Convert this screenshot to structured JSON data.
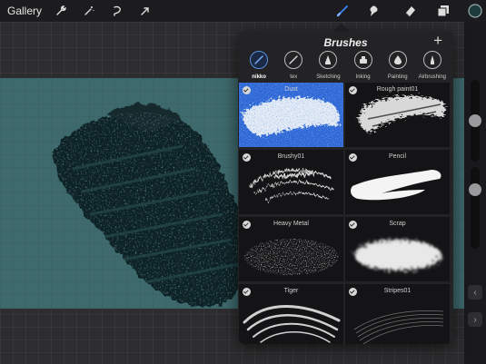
{
  "toolbar": {
    "gallery_label": "Gallery",
    "left_tools": [
      "wrench-icon",
      "magic-wand-icon",
      "selection-icon",
      "transform-arrow-icon"
    ],
    "right_tools": [
      "brush-icon",
      "smudge-icon",
      "eraser-icon",
      "layers-icon",
      "color-icon"
    ],
    "active_tool": "brush-icon",
    "accent": "#3a86ff",
    "current_color": "#1d3a3c"
  },
  "canvas": {
    "background": "#3e6a6d",
    "stroke_color": "#0f2426"
  },
  "brushes_panel": {
    "title": "Brushes",
    "add_label": "+",
    "sets": [
      {
        "label": "nikko",
        "icon": "pen-icon",
        "active": true
      },
      {
        "label": "tex",
        "icon": "brush-icon",
        "active": false
      },
      {
        "label": "Sketching",
        "icon": "pencil-tip-icon",
        "active": false
      },
      {
        "label": "Inking",
        "icon": "ink-pot-icon",
        "active": false
      },
      {
        "label": "Painting",
        "icon": "paint-drop-icon",
        "active": false
      },
      {
        "label": "Airbrushing",
        "icon": "airbrush-icon",
        "active": false
      }
    ],
    "brushes": [
      {
        "name": "Dust",
        "selected": true
      },
      {
        "name": "Rough paint01",
        "selected": false
      },
      {
        "name": "Brushy01",
        "selected": false
      },
      {
        "name": "Pencil",
        "selected": false
      },
      {
        "name": "Heavy Metal",
        "selected": false
      },
      {
        "name": "Scrap",
        "selected": false
      },
      {
        "name": "Tiger",
        "selected": false
      },
      {
        "name": "Stripes01",
        "selected": false
      }
    ]
  },
  "sidebar": {
    "size_slider_value": 0.2,
    "opacity_slider_value": 0.45,
    "undo_icon": "chevron-left-icon",
    "redo_icon": "chevron-right-icon"
  }
}
